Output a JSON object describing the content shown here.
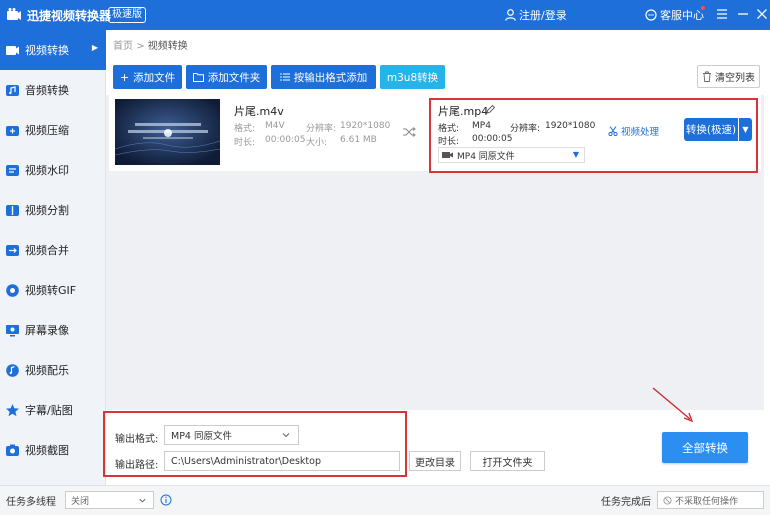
{
  "app": {
    "title": "迅捷视频转换器",
    "badge": "极速版",
    "login": "注册/登录",
    "service": "客服中心"
  },
  "sidebar": {
    "items": [
      {
        "label": "视频转换",
        "icon": "video-convert-icon",
        "active": true
      },
      {
        "label": "音频转换",
        "icon": "audio-convert-icon"
      },
      {
        "label": "视频压缩",
        "icon": "video-compress-icon"
      },
      {
        "label": "视频水印",
        "icon": "video-watermark-icon"
      },
      {
        "label": "视频分割",
        "icon": "video-split-icon"
      },
      {
        "label": "视频合并",
        "icon": "video-merge-icon"
      },
      {
        "label": "视频转GIF",
        "icon": "video-gif-icon"
      },
      {
        "label": "屏幕录像",
        "icon": "screen-record-icon"
      },
      {
        "label": "视频配乐",
        "icon": "video-music-icon"
      },
      {
        "label": "字幕/贴图",
        "icon": "subtitle-icon"
      },
      {
        "label": "视频截图",
        "icon": "video-screenshot-icon"
      }
    ]
  },
  "breadcrumb": {
    "home": "首页",
    "sep": ">",
    "current": "视频转换"
  },
  "toolbar": {
    "add_file": "添加文件",
    "add_folder": "添加文件夹",
    "add_by_format": "按输出格式添加",
    "m3u8": "m3u8转换",
    "clear_list": "清空列表"
  },
  "file": {
    "thumb_text": "中国网络视听节目服务 配套跨境在线视听平台建设方案",
    "source": {
      "name": "片尾.m4v",
      "format_label": "格式:",
      "format": "M4V",
      "resolution_label": "分辨率:",
      "resolution": "1920*1080",
      "duration_label": "时长:",
      "duration": "00:00:05",
      "size_label": "大小:",
      "size": "6.61 MB"
    },
    "output": {
      "name": "片尾.mp4",
      "format_label": "格式:",
      "format": "MP4",
      "resolution_label": "分辨率:",
      "resolution": "1920*1080",
      "duration_label": "时长:",
      "duration": "00:00:05",
      "format_select": "MP4   同原文件"
    },
    "video_process": "视频处理",
    "convert_button": "转换(极速)"
  },
  "bottom": {
    "output_format_label": "输出格式:",
    "output_format_value": "MP4   同原文件",
    "output_path_label": "输出路径:",
    "output_path_value": "C:\\Users\\Administrator\\Desktop",
    "change_dir": "更改目录",
    "open_folder": "打开文件夹",
    "convert_all": "全部转换"
  },
  "status": {
    "multithread_label": "任务多线程",
    "multithread_value": "关闭",
    "after_done_label": "任务完成后",
    "after_done_value": "不采取任何操作"
  },
  "colors": {
    "primary": "#1e6fd9",
    "teal": "#26b3e8",
    "highlight_red": "#d7353a",
    "convert_all": "#2b8ef0"
  }
}
